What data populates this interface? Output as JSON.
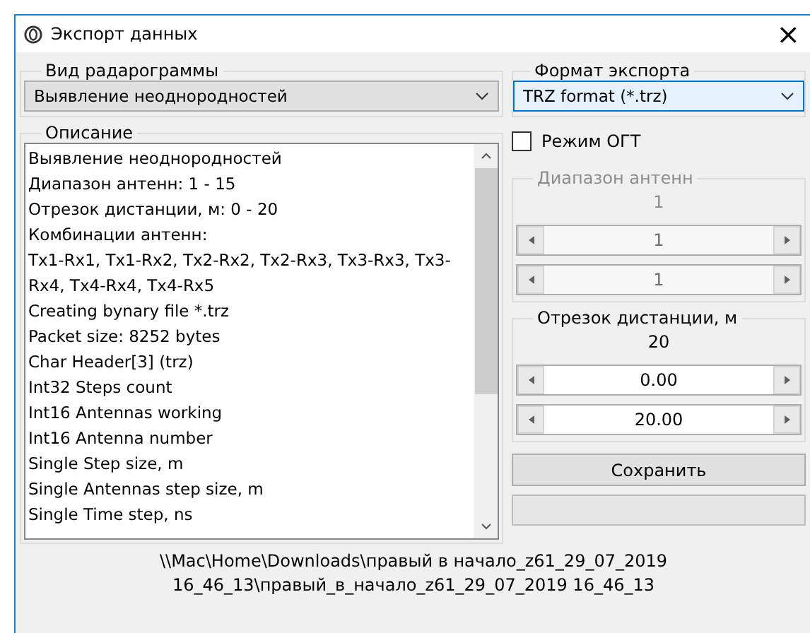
{
  "window": {
    "title": "Экспорт данных",
    "close": "×"
  },
  "left": {
    "radargram_group": {
      "title": "Вид радарограммы",
      "value": "Выявление неоднородностей"
    },
    "description_group": {
      "title": "Описание",
      "lines": [
        "Выявление неоднородностей",
        "Диапазон антенн: 1 - 15",
        "Отрезок дистанции, м: 0 - 20",
        "Комбинации антенн:",
        "Tx1-Rx1, Tx1-Rx2, Tx2-Rx2, Tx2-Rx3, Tx3-Rx3, Tx3-Rx4, Tx4-Rx4, Tx4-Rx5",
        "Creating bynary file *.trz",
        "Packet size: 8252 bytes",
        "Char Header[3] (trz)",
        "Int32 Steps count",
        "Int16 Antennas working",
        "Int16 Antenna number",
        "Single Step size, m",
        "Single Antennas step size, m",
        "Single Time step, ns"
      ]
    }
  },
  "right": {
    "format_group": {
      "title": "Формат экспорта",
      "value": "TRZ format (*.trz)"
    },
    "ogt_checkbox": {
      "label": "Режим ОГТ",
      "checked": false
    },
    "ranges": [
      {
        "title": "Диапазон антенн",
        "disabled": true,
        "reading": "1",
        "spinners": [
          "1",
          "1"
        ]
      },
      {
        "title": "Отрезок дистанции, м",
        "disabled": false,
        "reading": "20",
        "spinners": [
          "0.00",
          "20.00"
        ]
      }
    ],
    "save_button": "Сохранить",
    "progress": {
      "level": 0
    }
  },
  "status_lines": [
    "\\\\Mac\\Home\\Downloads\\правый в начало_z61_29_07_2019",
    "16_46_13\\правый_в_начало_z61_29_07_2019 16_46_13"
  ]
}
